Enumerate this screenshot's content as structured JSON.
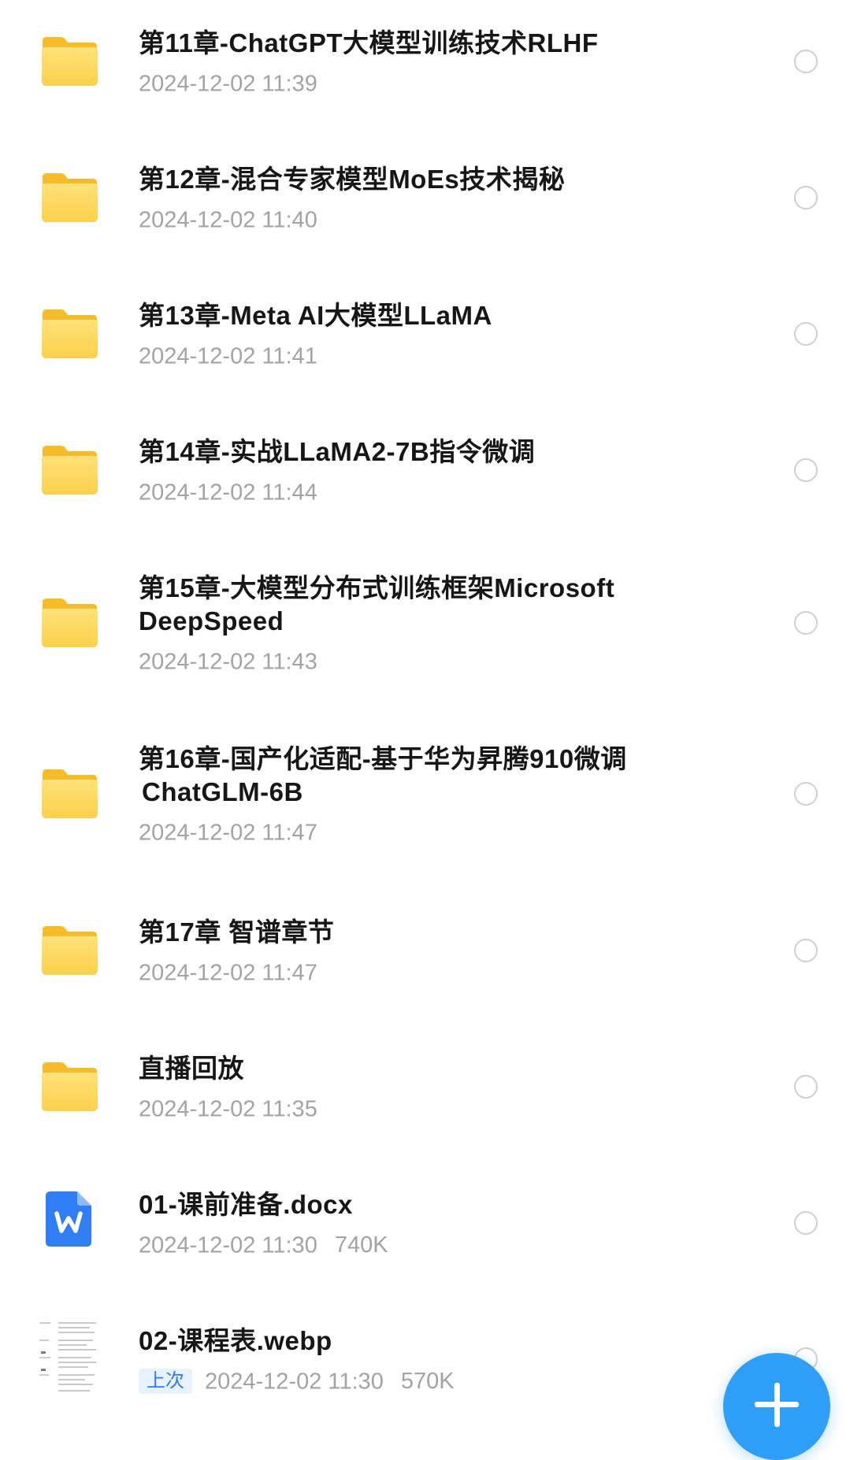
{
  "files": [
    {
      "type": "folder",
      "name": "第11章-ChatGPT大模型训练技术RLHF",
      "date": "2024-12-02 11:39"
    },
    {
      "type": "folder",
      "name": "第12章-混合专家模型MoEs技术揭秘",
      "date": "2024-12-02 11:40"
    },
    {
      "type": "folder",
      "name": "第13章-Meta AI大模型LLaMA",
      "date": "2024-12-02 11:41"
    },
    {
      "type": "folder",
      "name": "第14章-实战LLaMA2-7B指令微调",
      "date": "2024-12-02 11:44"
    },
    {
      "type": "folder",
      "name_line1": "第15章-大模型分布式训练框架Microsoft",
      "name_line2": "DeepSpeed",
      "date": "2024-12-02 11:43"
    },
    {
      "type": "folder",
      "name_line1": "第16章-国产化适配-基于华为昇腾910微调",
      "name_line2": "ChatGLM-6B",
      "date": "2024-12-02 11:47"
    },
    {
      "type": "folder",
      "name": "第17章 智谱章节",
      "date": "2024-12-02 11:47"
    },
    {
      "type": "folder",
      "name": "直播回放",
      "date": "2024-12-02 11:35"
    },
    {
      "type": "word-document",
      "name": "01-课前准备.docx",
      "date": "2024-12-02 11:30",
      "size": "740K"
    },
    {
      "type": "image",
      "name": "02-课程表.webp",
      "badge": "上次",
      "date": "2024-12-02 11:30",
      "size": "570K"
    }
  ],
  "icons": {
    "folder": "folder-icon",
    "word": "word-document-icon",
    "image": "image-thumbnail-icon",
    "checkbox": "select-circle-icon",
    "fab": "plus-icon"
  },
  "colors": {
    "folder": "#f8c93a",
    "word": "#2f7ef5",
    "fab": "#2e9ef7",
    "accent": "#2b7cf0",
    "meta_text": "#a3a3a3"
  }
}
